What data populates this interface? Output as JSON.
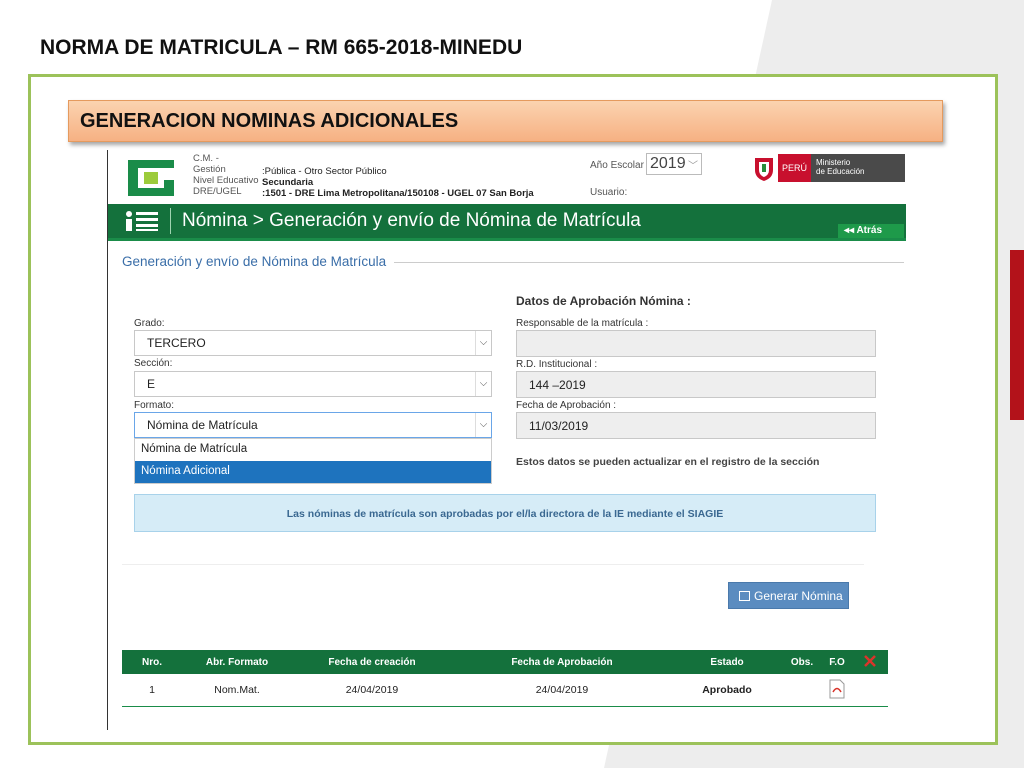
{
  "slide": {
    "title": "NORMA DE MATRICULA – RM 665-2018-MINEDU",
    "banner": "GENERACION NOMINAS ADICIONALES"
  },
  "header": {
    "labels": [
      "C.M. -",
      "Gestión",
      "Nivel Educativo",
      "DRE/UGEL"
    ],
    "gestion": ":Pública - Otro Sector Público",
    "nivel": "Secundaria",
    "dre": ":1501 - DRE Lima Metropolitana/150108 - UGEL 07 San Borja",
    "anio_label": "Año Escolar",
    "anio_value": "2019",
    "usuario_label": "Usuario:",
    "peru_label": "PERÚ",
    "ministerio_line1": "Ministerio",
    "ministerio_line2": "de Educación"
  },
  "nav": {
    "title": "Nómina > Generación y envío de Nómina de Matrícula",
    "back_label": "Atrás"
  },
  "form": {
    "section_title": "Generación y envío de Nómina de Matrícula",
    "grado_label": "Grado:",
    "grado_value": "TERCERO",
    "seccion_label": "Sección:",
    "seccion_value": "E",
    "formato_label": "Formato:",
    "formato_value": "Nómina de Matrícula",
    "formato_options": [
      "Nómina de Matrícula",
      "Nómina Adicional"
    ],
    "formato_highlighted": "Nómina Adicional"
  },
  "datos": {
    "title": "Datos de Aprobación Nómina :",
    "responsable_label": "Responsable de la matrícula :",
    "responsable_value": "",
    "rd_label": "R.D. Institucional :",
    "rd_value": "144 –2019",
    "fecha_label": "Fecha de Aprobación :",
    "fecha_value": "11/03/2019",
    "note": "Estos datos se pueden actualizar en el registro de la sección"
  },
  "info_message": "Las nóminas de matrícula son aprobadas por el/la directora de la IE mediante el SIAGIE",
  "generate_button": "Generar Nómina",
  "table": {
    "headers": [
      "Nro.",
      "Abr. Formato",
      "Fecha de creación",
      "Fecha de Aprobación",
      "Estado",
      "Obs.",
      "F.O"
    ],
    "rows": [
      {
        "nro": "1",
        "formato": "Nom.Mat.",
        "creacion": "24/04/2019",
        "aprobacion": "24/04/2019",
        "estado": "Aprobado",
        "obs": ""
      }
    ]
  },
  "colors": {
    "green_dark": "#14713c",
    "frame_green": "#9cc25a",
    "banner_orange": "#f6b183",
    "button_blue": "#5b8cc0",
    "highlight_blue": "#1e73be"
  }
}
